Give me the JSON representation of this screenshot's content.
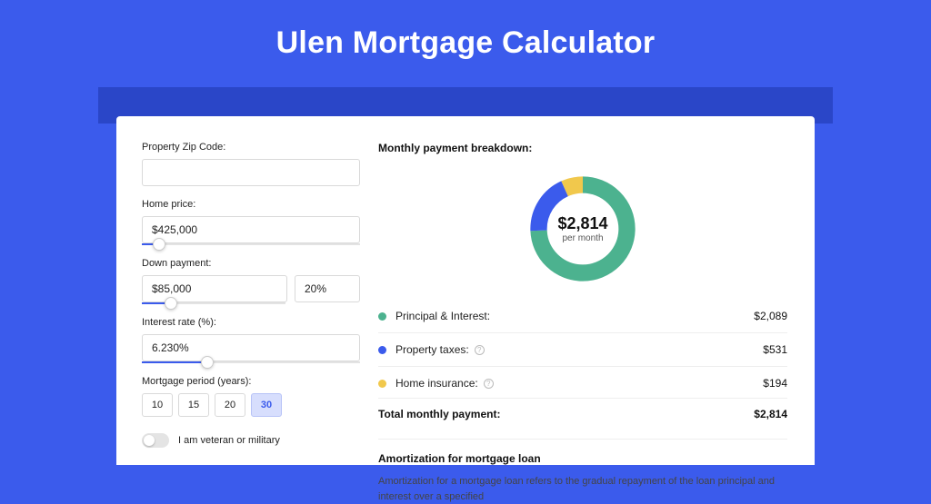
{
  "hero": {
    "title": "Ulen Mortgage Calculator"
  },
  "form": {
    "zip": {
      "label": "Property Zip Code:",
      "value": ""
    },
    "home_price": {
      "label": "Home price:",
      "value": "$425,000",
      "slider_pct": 8
    },
    "down_payment": {
      "label": "Down payment:",
      "value": "$85,000",
      "pct": "20%",
      "slider_pct": 20
    },
    "interest_rate": {
      "label": "Interest rate (%):",
      "value": "6.230%",
      "slider_pct": 30
    },
    "period": {
      "label": "Mortgage period (years):",
      "options": [
        "10",
        "15",
        "20",
        "30"
      ],
      "selected": "30"
    },
    "veteran": {
      "label": "I am veteran or military",
      "on": false
    }
  },
  "breakdown": {
    "title": "Monthly payment breakdown:",
    "center_amount": "$2,814",
    "center_sub": "per month",
    "items": [
      {
        "label": "Principal & Interest:",
        "value": "$2,089",
        "color": "#4cb28f",
        "info": false
      },
      {
        "label": "Property taxes:",
        "value": "$531",
        "color": "#3b5bec",
        "info": true
      },
      {
        "label": "Home insurance:",
        "value": "$194",
        "color": "#f1c84c",
        "info": true
      }
    ],
    "total_label": "Total monthly payment:",
    "total_value": "$2,814"
  },
  "chart_data": {
    "type": "pie",
    "title": "Monthly payment breakdown",
    "series": [
      {
        "name": "Principal & Interest",
        "value": 2089,
        "color": "#4cb28f"
      },
      {
        "name": "Property taxes",
        "value": 531,
        "color": "#3b5bec"
      },
      {
        "name": "Home insurance",
        "value": 194,
        "color": "#f1c84c"
      }
    ],
    "total": 2814,
    "unit": "USD per month"
  },
  "amortization": {
    "title": "Amortization for mortgage loan",
    "text": "Amortization for a mortgage loan refers to the gradual repayment of the loan principal and interest over a specified"
  }
}
